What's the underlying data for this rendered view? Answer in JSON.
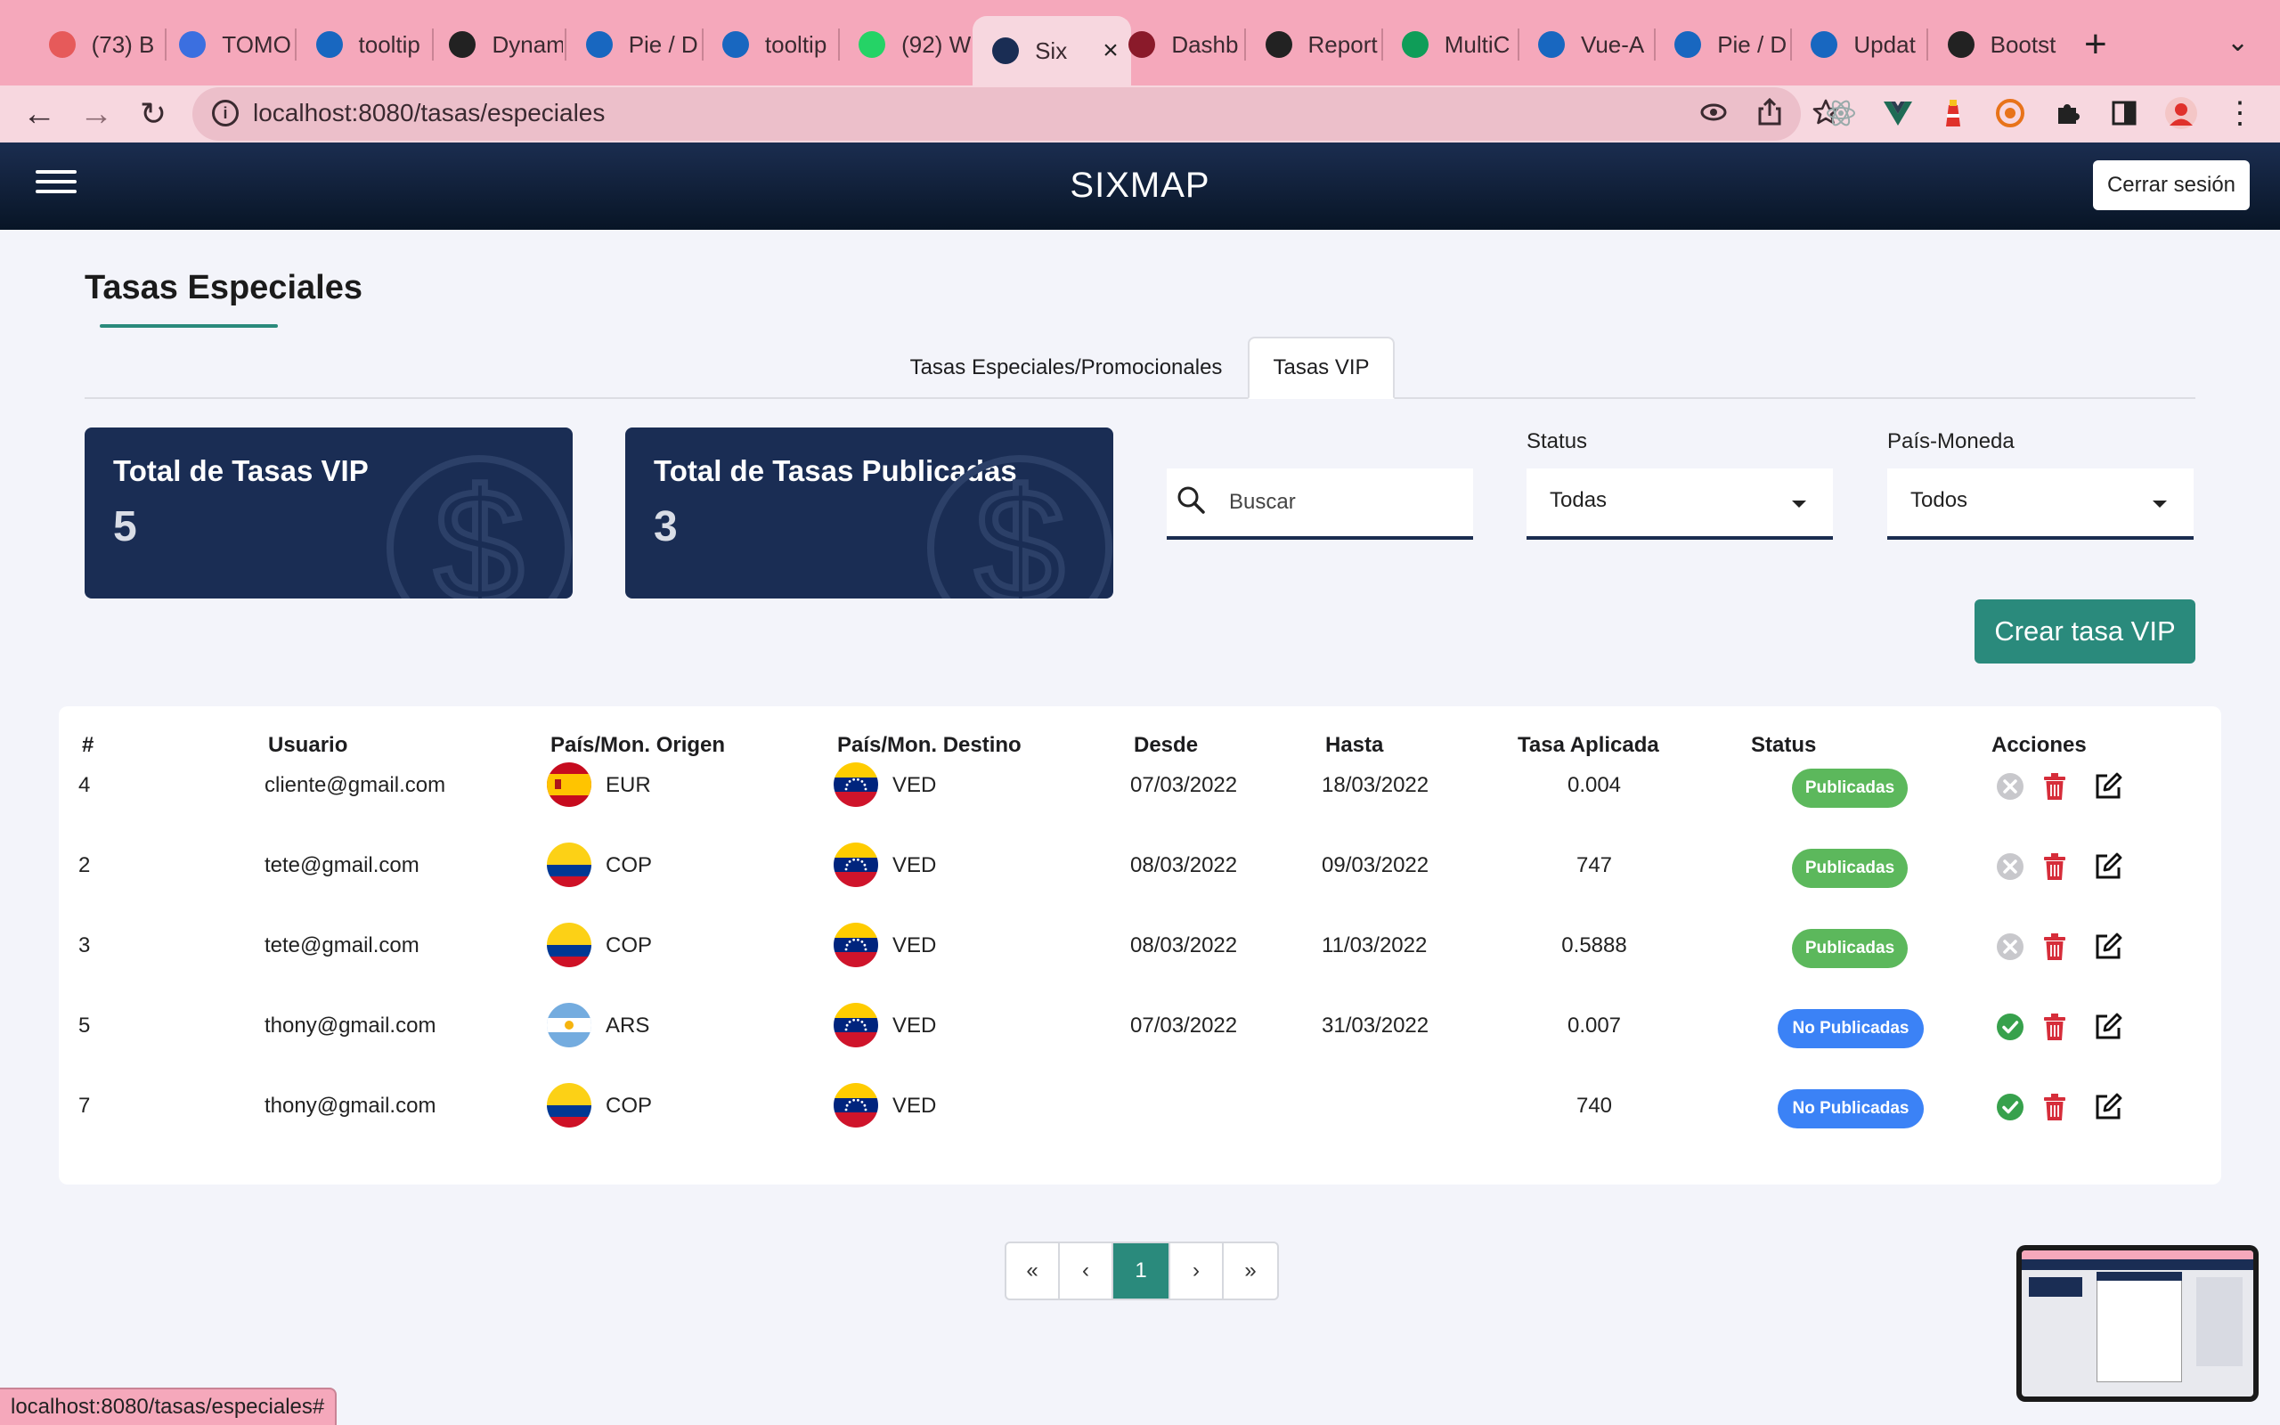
{
  "browser": {
    "tabs": [
      {
        "label": "(73) B",
        "icon": "palette-icon",
        "color": "#e65a5a"
      },
      {
        "label": "TOMO",
        "icon": "docs-icon",
        "color": "#3b6fe0"
      },
      {
        "label": "tooltip",
        "icon": "vuetify-icon",
        "color": "#1867c0"
      },
      {
        "label": "Dynam",
        "icon": "github-icon",
        "color": "#222222"
      },
      {
        "label": "Pie / D",
        "icon": "vuetify-icon",
        "color": "#1867c0"
      },
      {
        "label": "tooltip",
        "icon": "vuetify-icon",
        "color": "#1867c0"
      },
      {
        "label": "(92) W",
        "icon": "whatsapp-icon",
        "color": "#25d366"
      },
      {
        "label": "Six",
        "icon": "sixmap-icon",
        "color": "#1a2d54"
      },
      {
        "label": "Dashb",
        "icon": "remesa-icon",
        "color": "#8a1a2a"
      },
      {
        "label": "Report",
        "icon": "smiley-icon",
        "color": "#222222"
      },
      {
        "label": "MultiC",
        "icon": "sheets-icon",
        "color": "#0f9d58"
      },
      {
        "label": "Vue-A",
        "icon": "vuetify-icon",
        "color": "#1867c0"
      },
      {
        "label": "Pie / D",
        "icon": "vuetify-icon",
        "color": "#1867c0"
      },
      {
        "label": "Updat",
        "icon": "vuetify-icon",
        "color": "#1867c0"
      },
      {
        "label": "Bootst",
        "icon": "globe-icon",
        "color": "#222222"
      }
    ],
    "active_tab_index": 7,
    "url": "localhost:8080/tasas/especiales",
    "status_url": "localhost:8080/tasas/especiales#"
  },
  "app": {
    "brand": "SIXMAP",
    "logout_label": "Cerrar sesión"
  },
  "page": {
    "title": "Tasas Especiales",
    "tabs": [
      {
        "label": "Tasas Especiales/Promocionales",
        "active": false
      },
      {
        "label": "Tasas VIP",
        "active": true
      }
    ],
    "cards": [
      {
        "title": "Total de Tasas VIP",
        "value": "5"
      },
      {
        "title": "Total de Tasas Publicadas",
        "value": "3"
      }
    ],
    "search": {
      "placeholder": "Buscar",
      "value": ""
    },
    "filters": {
      "status": {
        "label": "Status",
        "value": "Todas"
      },
      "country_currency": {
        "label": "País-Moneda",
        "value": "Todos"
      }
    },
    "create_button": "Crear tasa VIP"
  },
  "table": {
    "headers": [
      "#",
      "Usuario",
      "País/Mon. Origen",
      "País/Mon. Destino",
      "Desde",
      "Hasta",
      "Tasa Aplicada",
      "Status",
      "Acciones"
    ],
    "rows": [
      {
        "id": "4",
        "user": "cliente@gmail.com",
        "origin": "EUR",
        "origin_flag": "spain-flag-icon",
        "dest": "VED",
        "dest_flag": "venezuela-flag-icon",
        "from": "07/03/2022",
        "to": "18/03/2022",
        "rate": "0.004",
        "status": "Publicadas",
        "published": true
      },
      {
        "id": "2",
        "user": "tete@gmail.com",
        "origin": "COP",
        "origin_flag": "colombia-flag-icon",
        "dest": "VED",
        "dest_flag": "venezuela-flag-icon",
        "from": "08/03/2022",
        "to": "09/03/2022",
        "rate": "747",
        "status": "Publicadas",
        "published": true
      },
      {
        "id": "3",
        "user": "tete@gmail.com",
        "origin": "COP",
        "origin_flag": "colombia-flag-icon",
        "dest": "VED",
        "dest_flag": "venezuela-flag-icon",
        "from": "08/03/2022",
        "to": "11/03/2022",
        "rate": "0.5888",
        "status": "Publicadas",
        "published": true
      },
      {
        "id": "5",
        "user": "thony@gmail.com",
        "origin": "ARS",
        "origin_flag": "argentina-flag-icon",
        "dest": "VED",
        "dest_flag": "venezuela-flag-icon",
        "from": "07/03/2022",
        "to": "31/03/2022",
        "rate": "0.007",
        "status": "No Publicadas",
        "published": false
      },
      {
        "id": "7",
        "user": "thony@gmail.com",
        "origin": "COP",
        "origin_flag": "colombia-flag-icon",
        "dest": "VED",
        "dest_flag": "venezuela-flag-icon",
        "from": "",
        "to": "",
        "rate": "740",
        "status": "No Publicadas",
        "published": false
      }
    ]
  },
  "pagination": {
    "first": "«",
    "prev": "‹",
    "current": "1",
    "next": "›",
    "last": "»"
  },
  "colors": {
    "primary_navy": "#1a2d54",
    "accent_teal": "#2a8a7c",
    "published_green": "#5cb85c",
    "unpublished_blue": "#3b82f6",
    "delete_red": "#d62d3a",
    "tab_strip_pink": "#f5a8bb"
  }
}
